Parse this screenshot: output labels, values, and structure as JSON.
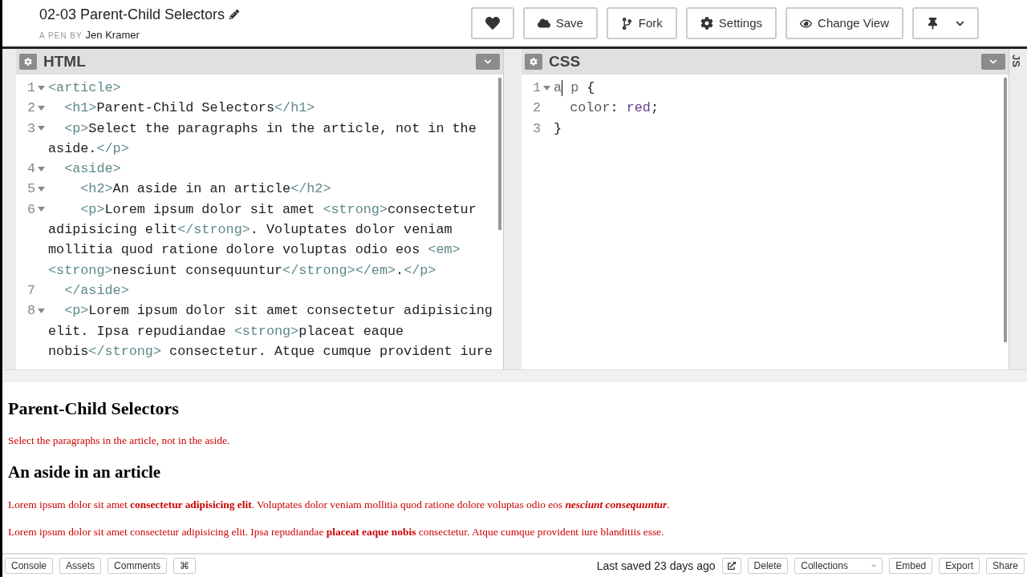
{
  "header": {
    "title": "02-03 Parent-Child Selectors",
    "byline_prefix": "A PEN BY",
    "author": "Jen Kramer",
    "buttons": [
      {
        "kind": "heart"
      },
      {
        "kind": "cloud",
        "label": "Save"
      },
      {
        "kind": "fork",
        "label": "Fork"
      },
      {
        "kind": "gear",
        "label": "Settings"
      },
      {
        "kind": "view",
        "label": "Change View"
      },
      {
        "kind": "pin"
      }
    ]
  },
  "editors": [
    {
      "title": "HTML",
      "lines": [
        {
          "number": "1",
          "fold": true,
          "rows": [
            [
              {
                "kind": "tag",
                "text": "<article>"
              }
            ]
          ]
        },
        {
          "number": "2",
          "fold": true,
          "rows": [
            [
              {
                "kind": "tag",
                "text": "  <h1>"
              },
              {
                "kind": "text",
                "text": "Parent-Child Selectors"
              },
              {
                "kind": "tag",
                "text": "</h1>"
              }
            ]
          ]
        },
        {
          "number": "3",
          "fold": true,
          "rows": [
            [
              {
                "kind": "tag",
                "text": "  <p>"
              },
              {
                "kind": "text",
                "text": "Select the paragraphs in the article, not in the"
              }
            ],
            [
              {
                "kind": "text",
                "text": "aside."
              },
              {
                "kind": "tag",
                "text": "</p>"
              }
            ]
          ]
        },
        {
          "number": "4",
          "fold": true,
          "rows": [
            [
              {
                "kind": "tag",
                "text": "  <aside>"
              }
            ]
          ]
        },
        {
          "number": "5",
          "fold": true,
          "rows": [
            [
              {
                "kind": "tag",
                "text": "    <h2>"
              },
              {
                "kind": "text",
                "text": "An aside in an article"
              },
              {
                "kind": "tag",
                "text": "</h2>"
              }
            ]
          ]
        },
        {
          "number": "6",
          "fold": true,
          "rows": [
            [
              {
                "kind": "tag",
                "text": "    <p>"
              },
              {
                "kind": "text",
                "text": "Lorem ipsum dolor sit amet "
              },
              {
                "kind": "tag",
                "text": "<strong>"
              },
              {
                "kind": "text",
                "text": "consectetur"
              }
            ],
            [
              {
                "kind": "text",
                "text": "adipisicing elit"
              },
              {
                "kind": "tag",
                "text": "</strong>"
              },
              {
                "kind": "text",
                "text": ". Voluptates dolor veniam"
              }
            ],
            [
              {
                "kind": "text",
                "text": "mollitia quod ratione dolore voluptas odio eos "
              },
              {
                "kind": "tag",
                "text": "<em>"
              }
            ],
            [
              {
                "kind": "tag",
                "text": "<strong>"
              },
              {
                "kind": "text",
                "text": "nesciunt consequuntur"
              },
              {
                "kind": "tag",
                "text": "</strong></em>"
              },
              {
                "kind": "text",
                "text": "."
              },
              {
                "kind": "tag",
                "text": "</p>"
              }
            ]
          ]
        },
        {
          "number": "7",
          "fold": false,
          "rows": [
            [
              {
                "kind": "tag",
                "text": "  </aside>"
              }
            ]
          ]
        },
        {
          "number": "8",
          "fold": true,
          "rows": [
            [
              {
                "kind": "tag",
                "text": "  <p>"
              },
              {
                "kind": "text",
                "text": "Lorem ipsum dolor sit amet consectetur adipisicing"
              }
            ],
            [
              {
                "kind": "text",
                "text": "elit. Ipsa repudiandae "
              },
              {
                "kind": "tag",
                "text": "<strong>"
              },
              {
                "kind": "text",
                "text": "placeat eaque"
              }
            ],
            [
              {
                "kind": "text",
                "text": "nobis"
              },
              {
                "kind": "tag",
                "text": "</strong>"
              },
              {
                "kind": "text",
                "text": " consectetur. Atque cumque provident iure"
              }
            ]
          ]
        }
      ]
    },
    {
      "title": "CSS",
      "lines": [
        {
          "number": "1",
          "fold": true,
          "rows": [
            [
              {
                "kind": "selector",
                "text": "a"
              },
              {
                "kind": "cursor",
                "text": ""
              },
              {
                "kind": "selector",
                "text": " p"
              },
              {
                "kind": "text",
                "text": " {"
              }
            ]
          ]
        },
        {
          "number": "2",
          "fold": false,
          "rows": [
            [
              {
                "kind": "property",
                "text": "  color"
              },
              {
                "kind": "text",
                "text": ": "
              },
              {
                "kind": "value",
                "text": "red"
              },
              {
                "kind": "text",
                "text": ";"
              }
            ]
          ]
        },
        {
          "number": "3",
          "fold": false,
          "rows": [
            [
              {
                "kind": "text",
                "text": "}"
              }
            ]
          ]
        }
      ]
    }
  ],
  "side_tab": "JS",
  "preview": [
    {
      "kind": "h1",
      "text": "Parent-Child Selectors"
    },
    {
      "kind": "p",
      "text": "Select the paragraphs in the article, not in the aside."
    },
    {
      "kind": "h2",
      "text": "An aside in an article"
    },
    {
      "kind": "p",
      "segments": [
        {
          "text": "Lorem ipsum dolor sit amet "
        },
        {
          "text": "consectetur adipisicing elit",
          "bold": true
        },
        {
          "text": ". Voluptates dolor veniam mollitia quod ratione dolore voluptas odio eos "
        },
        {
          "text": "nesciunt consequuntur",
          "bold": true,
          "italic": true
        },
        {
          "text": "."
        }
      ]
    },
    {
      "kind": "p",
      "segments": [
        {
          "text": "Lorem ipsum dolor sit amet consectetur adipisicing elit. Ipsa repudiandae "
        },
        {
          "text": "placeat eaque nobis",
          "bold": true
        },
        {
          "text": " consectetur. Atque cumque provident iure blanditiis esse."
        }
      ]
    }
  ],
  "footer": {
    "left": [
      "Console",
      "Assets",
      "Comments",
      "⌘"
    ],
    "status": "Last saved 23 days ago",
    "right": [
      {
        "kind": "external"
      },
      {
        "kind": "button",
        "label": "Delete"
      },
      {
        "kind": "select",
        "label": "Collections"
      },
      {
        "kind": "button",
        "label": "Embed"
      },
      {
        "kind": "button",
        "label": "Export"
      },
      {
        "kind": "button",
        "label": "Share"
      }
    ]
  }
}
